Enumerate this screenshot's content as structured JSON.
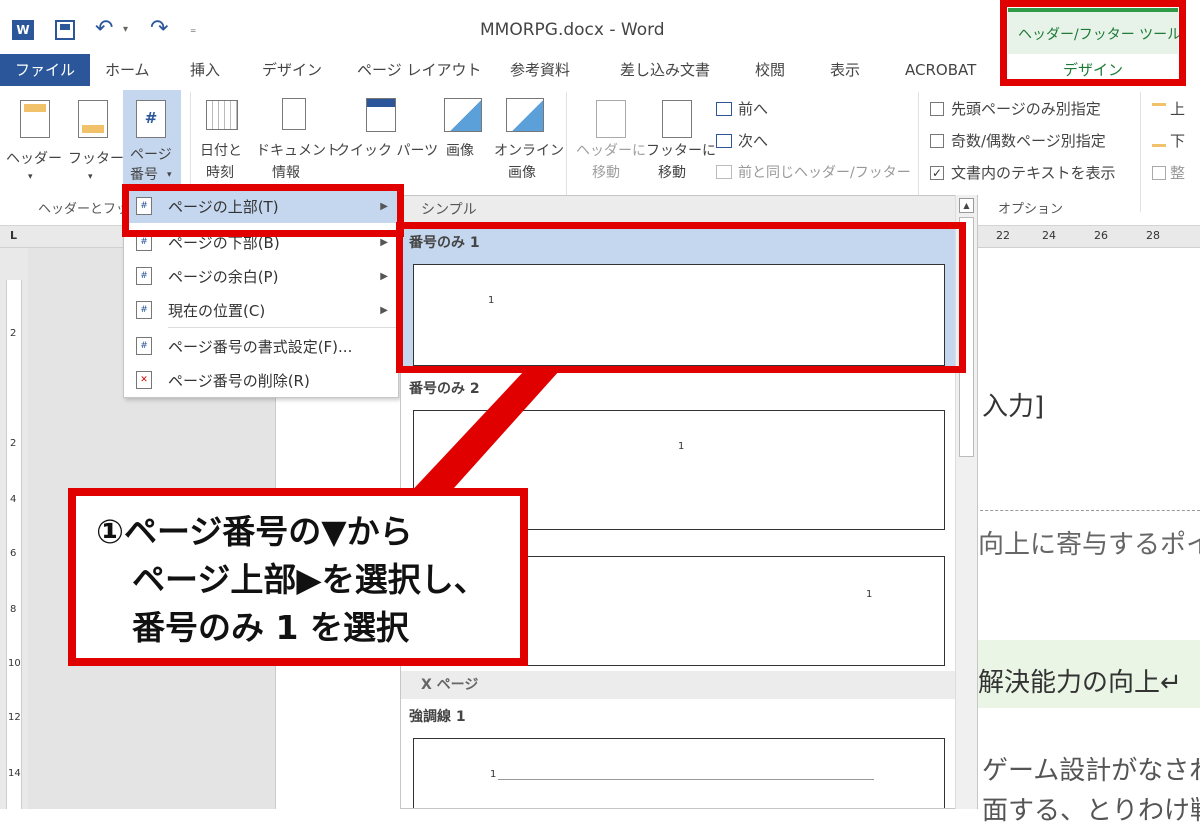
{
  "window": {
    "title": "MMORPG.docx - Word",
    "contextual_tab_group": "ヘッダー/フッター ツール"
  },
  "quick_access": {
    "app_icon": "word-icon",
    "save_icon": "save-icon",
    "undo_icon": "undo-icon",
    "redo_icon": "redo-icon",
    "customize_icon": "customize-icon"
  },
  "tabs": [
    {
      "label": "ファイル"
    },
    {
      "label": "ホーム"
    },
    {
      "label": "挿入"
    },
    {
      "label": "デザイン"
    },
    {
      "label": "ページ レイアウト"
    },
    {
      "label": "参考資料"
    },
    {
      "label": "差し込み文書"
    },
    {
      "label": "校閲"
    },
    {
      "label": "表示"
    },
    {
      "label": "ACROBAT"
    },
    {
      "label": "デザイン"
    }
  ],
  "ribbon": {
    "header": "ヘッダー",
    "footer": "フッター",
    "page_number_1": "ページ",
    "page_number_2": "番号",
    "date_1": "日付と",
    "date_2": "時刻",
    "docinfo_1": "ドキュメント",
    "docinfo_2": "情報",
    "quickparts": "クイック パーツ",
    "picture": "画像",
    "online_1": "オンライン",
    "online_2": "画像",
    "goto_header_1": "ヘッダーに",
    "goto_header_2": "移動",
    "goto_footer_1": "フッターに",
    "goto_footer_2": "移動",
    "prev": "前へ",
    "next": "次へ",
    "link_prev": "前と同じヘッダー/フッター",
    "group_header_footer": "ヘッダーとフッ",
    "opt_first_page": "先頭ページのみ別指定",
    "opt_odd_even": "奇数/偶数ページ別指定",
    "opt_show_text": "文書内のテキストを表示",
    "group_options": "オプション",
    "pos_top": "上",
    "pos_bottom": "下",
    "pos_align": "整"
  },
  "ruler": {
    "corner": "L",
    "h_ticks": [
      "22",
      "24",
      "26",
      "28"
    ],
    "v_ticks": [
      "2",
      "2",
      "4",
      "6",
      "8",
      "10",
      "12",
      "14"
    ]
  },
  "menu": {
    "items": [
      {
        "label": "ページの上部(T)",
        "submenu": true
      },
      {
        "label": "ページの下部(B)",
        "submenu": true
      },
      {
        "label": "ページの余白(P)",
        "submenu": true
      },
      {
        "label": "現在の位置(C)",
        "submenu": true
      },
      {
        "label": "ページ番号の書式設定(F)...",
        "submenu": false
      },
      {
        "label": "ページ番号の削除(R)",
        "submenu": false
      }
    ]
  },
  "gallery": {
    "section_simple": "シンプル",
    "item1": "番号のみ 1",
    "item2": "番号のみ 2",
    "section_xpage": "X ページ",
    "item4": "強調線 1",
    "thumb_num": "1"
  },
  "document": {
    "line1": "入力]",
    "line2": "向上に寄与するポイ",
    "line3": "解決能力の向上↵",
    "line4": "ゲーム設計がなされて",
    "line5": "面する、とりわけ戦闘"
  },
  "callout": {
    "line1": "①ページ番号の▼から",
    "line2": "ページ上部▶を選択し、",
    "line3": "番号のみ 1 を選択"
  },
  "colors": {
    "accent": "#2b579a",
    "highlight_red": "#e00000",
    "contextual_green": "#217346"
  }
}
